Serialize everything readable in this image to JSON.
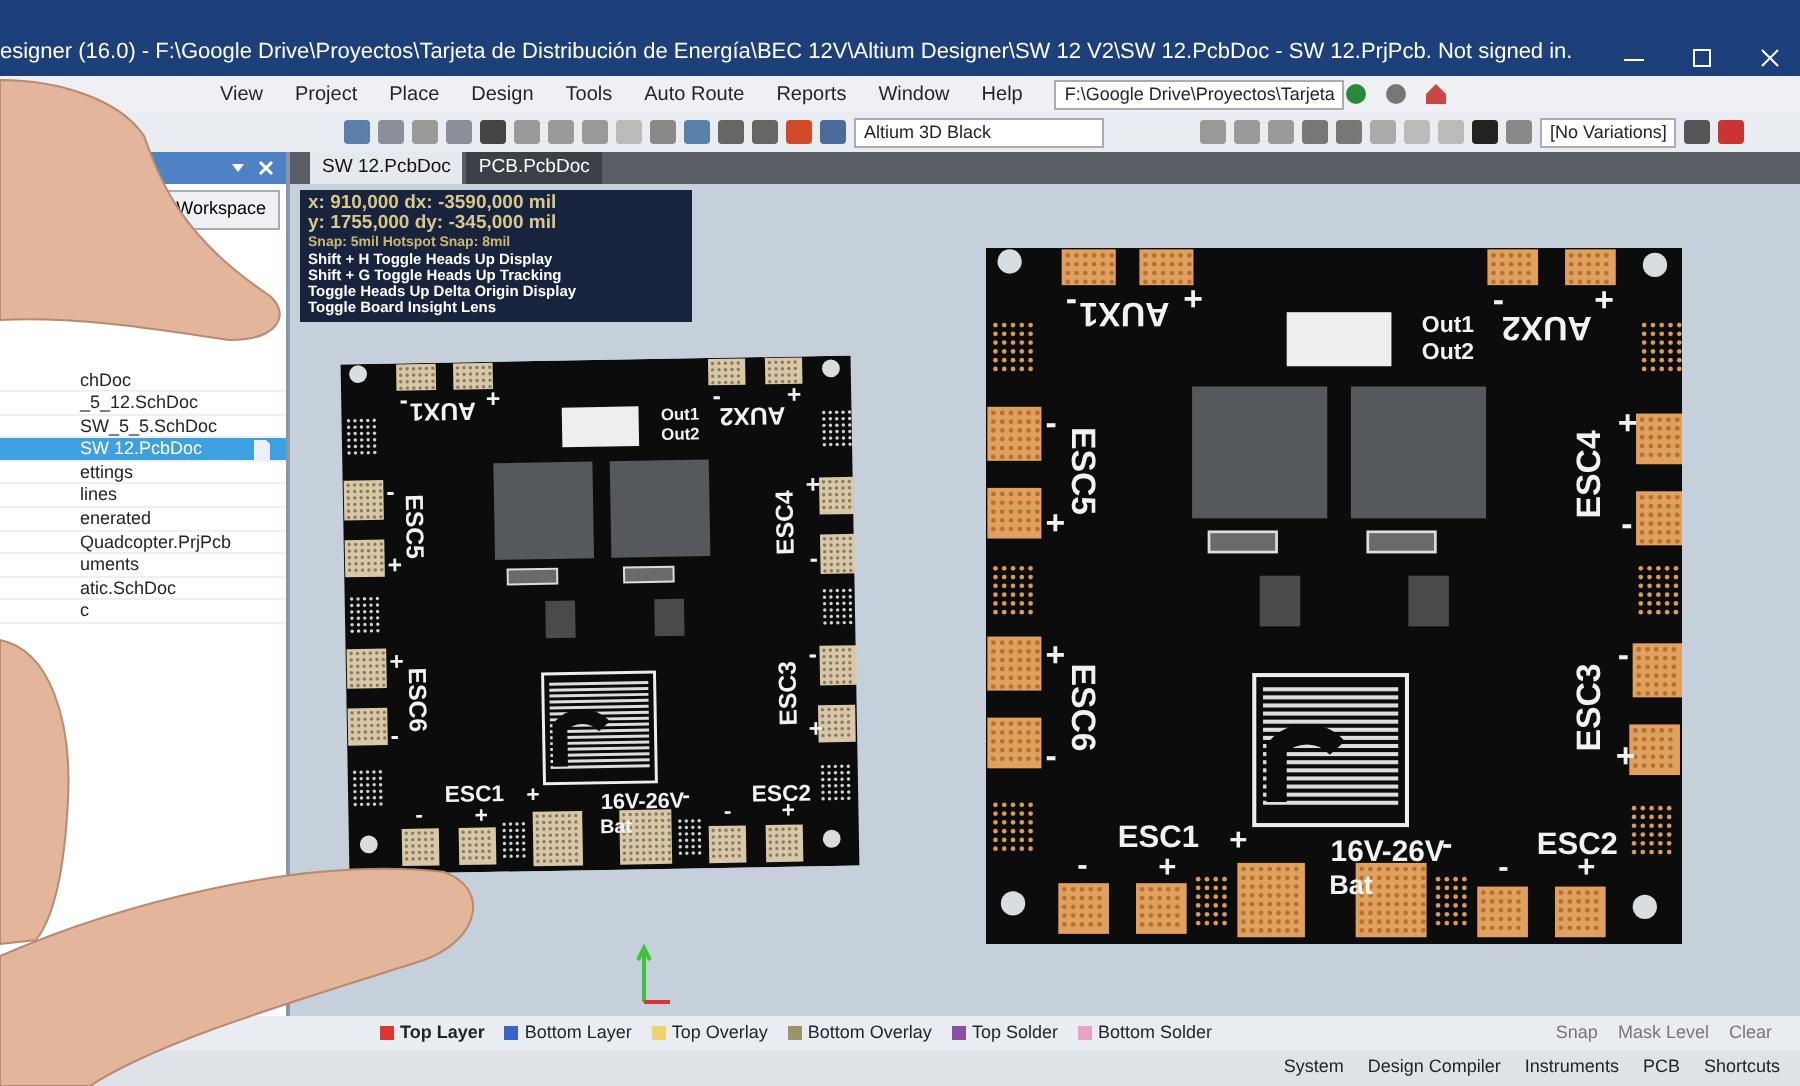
{
  "window": {
    "title": "esigner (16.0) - F:\\Google Drive\\Proyectos\\Tarjeta de Distribución de Energía\\BEC 12V\\Altium Designer\\SW 12 V2\\SW 12.PcbDoc - SW 12.PrjPcb. Not signed in."
  },
  "menu": [
    "View",
    "Project",
    "Place",
    "Design",
    "Tools",
    "Auto Route",
    "Reports",
    "Window",
    "Help"
  ],
  "path_field": {
    "value": "F:\\Google Drive\\Proyectos\\Tarjeta"
  },
  "toolbar": {
    "view_config": "Altium 3D Black",
    "variations": "[No Variations]"
  },
  "panel": {
    "button": "Workspace",
    "items": [
      {
        "label": "chDoc",
        "selected": false
      },
      {
        "label": "_5_12.SchDoc",
        "selected": false
      },
      {
        "label": "SW_5_5.SchDoc",
        "selected": false
      },
      {
        "label": "SW 12.PcbDoc",
        "selected": true
      },
      {
        "label": "ettings",
        "selected": false
      },
      {
        "label": "lines",
        "selected": false
      },
      {
        "label": "enerated",
        "selected": false
      },
      {
        "label": "Quadcopter.PrjPcb",
        "selected": false
      },
      {
        "label": "uments",
        "selected": false
      },
      {
        "label": "atic.SchDoc",
        "selected": false
      },
      {
        "label": "c",
        "selected": false
      }
    ]
  },
  "tabs": [
    {
      "label": "SW 12.PcbDoc",
      "selected": true
    },
    {
      "label": "PCB.PcbDoc",
      "selected": false
    }
  ],
  "hud": {
    "lines": [
      {
        "kind": "coords",
        "text": "x:  910,000   dx: -3590,000 mil"
      },
      {
        "kind": "coords",
        "text": "y:  1755,000  dy:  -345,000 mil"
      },
      {
        "kind": "snap",
        "text": "Snap: 5mil Hotspot Snap: 8mil"
      },
      {
        "kind": "shortcut",
        "text": "Shift + H  Toggle Heads Up Display"
      },
      {
        "kind": "shortcut",
        "text": "Shift + G  Toggle Heads Up Tracking"
      },
      {
        "kind": "shortcut",
        "text": "Toggle Heads Up Delta Origin Display"
      },
      {
        "kind": "shortcut",
        "text": "Toggle Board Insight Lens"
      }
    ]
  },
  "boards": [
    {
      "kind": "physical",
      "labels": [
        "AUX1",
        "-",
        "+",
        "AUX2",
        "-",
        "+",
        "ESC5",
        "-",
        "+",
        "ESC4",
        "+",
        "-",
        "ESC6",
        "+",
        "-",
        "ESC3",
        "-",
        "+",
        "ESC1",
        "-",
        "+",
        "ESC2",
        "-",
        "+",
        "+",
        "16V-26V",
        "-",
        "Bat",
        "Out1",
        "Out2"
      ]
    },
    {
      "kind": "render",
      "labels": [
        "AUX1",
        "-",
        "+",
        "AUX2",
        "-",
        "+",
        "ESC5",
        "-",
        "+",
        "ESC4",
        "+",
        "-",
        "ESC6",
        "+",
        "-",
        "ESC3",
        "-",
        "+",
        "ESC1",
        "-",
        "+",
        "ESC2",
        "-",
        "+",
        "+",
        "16V-26V",
        "-",
        "Bat",
        "Out1",
        "Out2"
      ]
    }
  ],
  "layers": [
    {
      "label": "Top Layer",
      "color": "#d9382f",
      "selected": true
    },
    {
      "label": "Bottom Layer",
      "color": "#3a64c8",
      "selected": false
    },
    {
      "label": "Top Overlay",
      "color": "#f0d070",
      "selected": false
    },
    {
      "label": "Bottom Overlay",
      "color": "#9a9566",
      "selected": false
    },
    {
      "label": "Top Solder",
      "color": "#8a4fa8",
      "selected": false
    },
    {
      "label": "Bottom Solder",
      "color": "#e8a2c4",
      "selected": false
    }
  ],
  "layer_bar_right": [
    "Snap",
    "Mask Level",
    "Clear"
  ],
  "status_bar": [
    "System",
    "Design Compiler",
    "Instruments",
    "PCB",
    "Shortcuts"
  ]
}
